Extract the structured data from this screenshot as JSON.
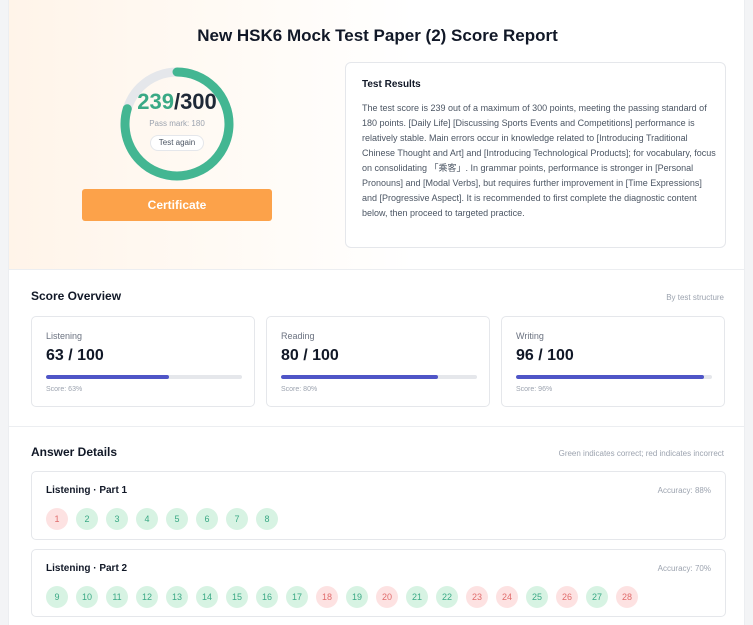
{
  "report": {
    "title": "New HSK6 Mock Test Paper (2) Score Report",
    "score": "239",
    "max_score": "300",
    "score_value": 239,
    "max_value": 300,
    "pass_mark": "Pass mark: 180",
    "test_again_label": "Test again",
    "certificate_label": "Certificate"
  },
  "results": {
    "title": "Test Results",
    "text": "The test score is 239 out of a maximum of 300 points, meeting the passing standard of 180 points. [Daily Life] [Discussing Sports Events and Competitions] performance is relatively stable. Main errors occur in knowledge related to [Introducing Traditional Chinese Thought and Art] and [Introducing Technological Products]; for vocabulary, focus on consolidating 「乘客」. In grammar points, performance is stronger in [Personal Pronouns] and [Modal Verbs], but requires further improvement in [Time Expressions] and [Progressive Aspect]. It is recommended to first complete the diagnostic content below, then proceed to targeted practice."
  },
  "overview": {
    "title": "Score Overview",
    "note": "By test structure",
    "cards": [
      {
        "label": "Listening",
        "value": "63 / 100",
        "percent": 63,
        "score_text": "Score: 63%"
      },
      {
        "label": "Reading",
        "value": "80 / 100",
        "percent": 80,
        "score_text": "Score: 80%"
      },
      {
        "label": "Writing",
        "value": "96 / 100",
        "percent": 96,
        "score_text": "Score: 96%"
      }
    ]
  },
  "details": {
    "title": "Answer Details",
    "note": "Green indicates correct; red indicates incorrect",
    "parts": [
      {
        "title": "Listening · Part 1",
        "accuracy": "Accuracy: 88%",
        "answers": [
          {
            "n": "1",
            "correct": false
          },
          {
            "n": "2",
            "correct": true
          },
          {
            "n": "3",
            "correct": true
          },
          {
            "n": "4",
            "correct": true
          },
          {
            "n": "5",
            "correct": true
          },
          {
            "n": "6",
            "correct": true
          },
          {
            "n": "7",
            "correct": true
          },
          {
            "n": "8",
            "correct": true
          }
        ]
      },
      {
        "title": "Listening · Part 2",
        "accuracy": "Accuracy: 70%",
        "answers": [
          {
            "n": "9",
            "correct": true
          },
          {
            "n": "10",
            "correct": true
          },
          {
            "n": "11",
            "correct": true
          },
          {
            "n": "12",
            "correct": true
          },
          {
            "n": "13",
            "correct": true
          },
          {
            "n": "14",
            "correct": true
          },
          {
            "n": "15",
            "correct": true
          },
          {
            "n": "16",
            "correct": true
          },
          {
            "n": "17",
            "correct": true
          },
          {
            "n": "18",
            "correct": false
          },
          {
            "n": "19",
            "correct": true
          },
          {
            "n": "20",
            "correct": false
          },
          {
            "n": "21",
            "correct": true
          },
          {
            "n": "22",
            "correct": true
          },
          {
            "n": "23",
            "correct": false
          },
          {
            "n": "24",
            "correct": false
          },
          {
            "n": "25",
            "correct": true
          },
          {
            "n": "26",
            "correct": false
          },
          {
            "n": "27",
            "correct": true
          },
          {
            "n": "28",
            "correct": false
          }
        ]
      }
    ]
  },
  "colors": {
    "accent_green": "#3aa985",
    "ring_track": "#e5e7eb",
    "certificate": "#fca24a",
    "progress": "#4f55c7",
    "correct_bg": "#d7f3e3",
    "incorrect_bg": "#fde2e2"
  }
}
